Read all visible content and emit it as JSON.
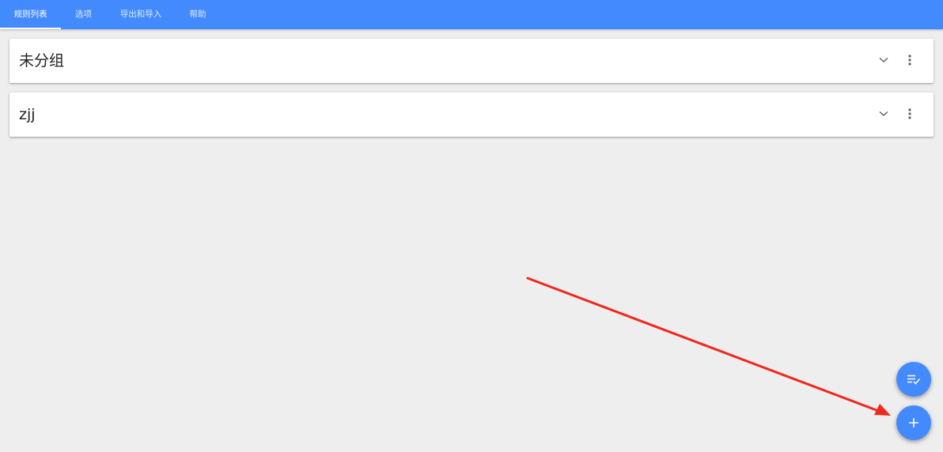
{
  "tabs": [
    {
      "label": "规则列表",
      "active": true
    },
    {
      "label": "选项",
      "active": false
    },
    {
      "label": "导出和导入",
      "active": false
    },
    {
      "label": "帮助",
      "active": false
    }
  ],
  "groups": [
    {
      "title": "未分组"
    },
    {
      "title": "zjj"
    }
  ],
  "icons": {
    "expand": "chevron-down-icon",
    "more": "more-vertical-icon",
    "fab_list": "playlist-check-icon",
    "fab_add": "plus-icon"
  },
  "colors": {
    "accent": "#448aff",
    "background": "#eeeeee",
    "annotation_arrow": "#f0281e"
  }
}
